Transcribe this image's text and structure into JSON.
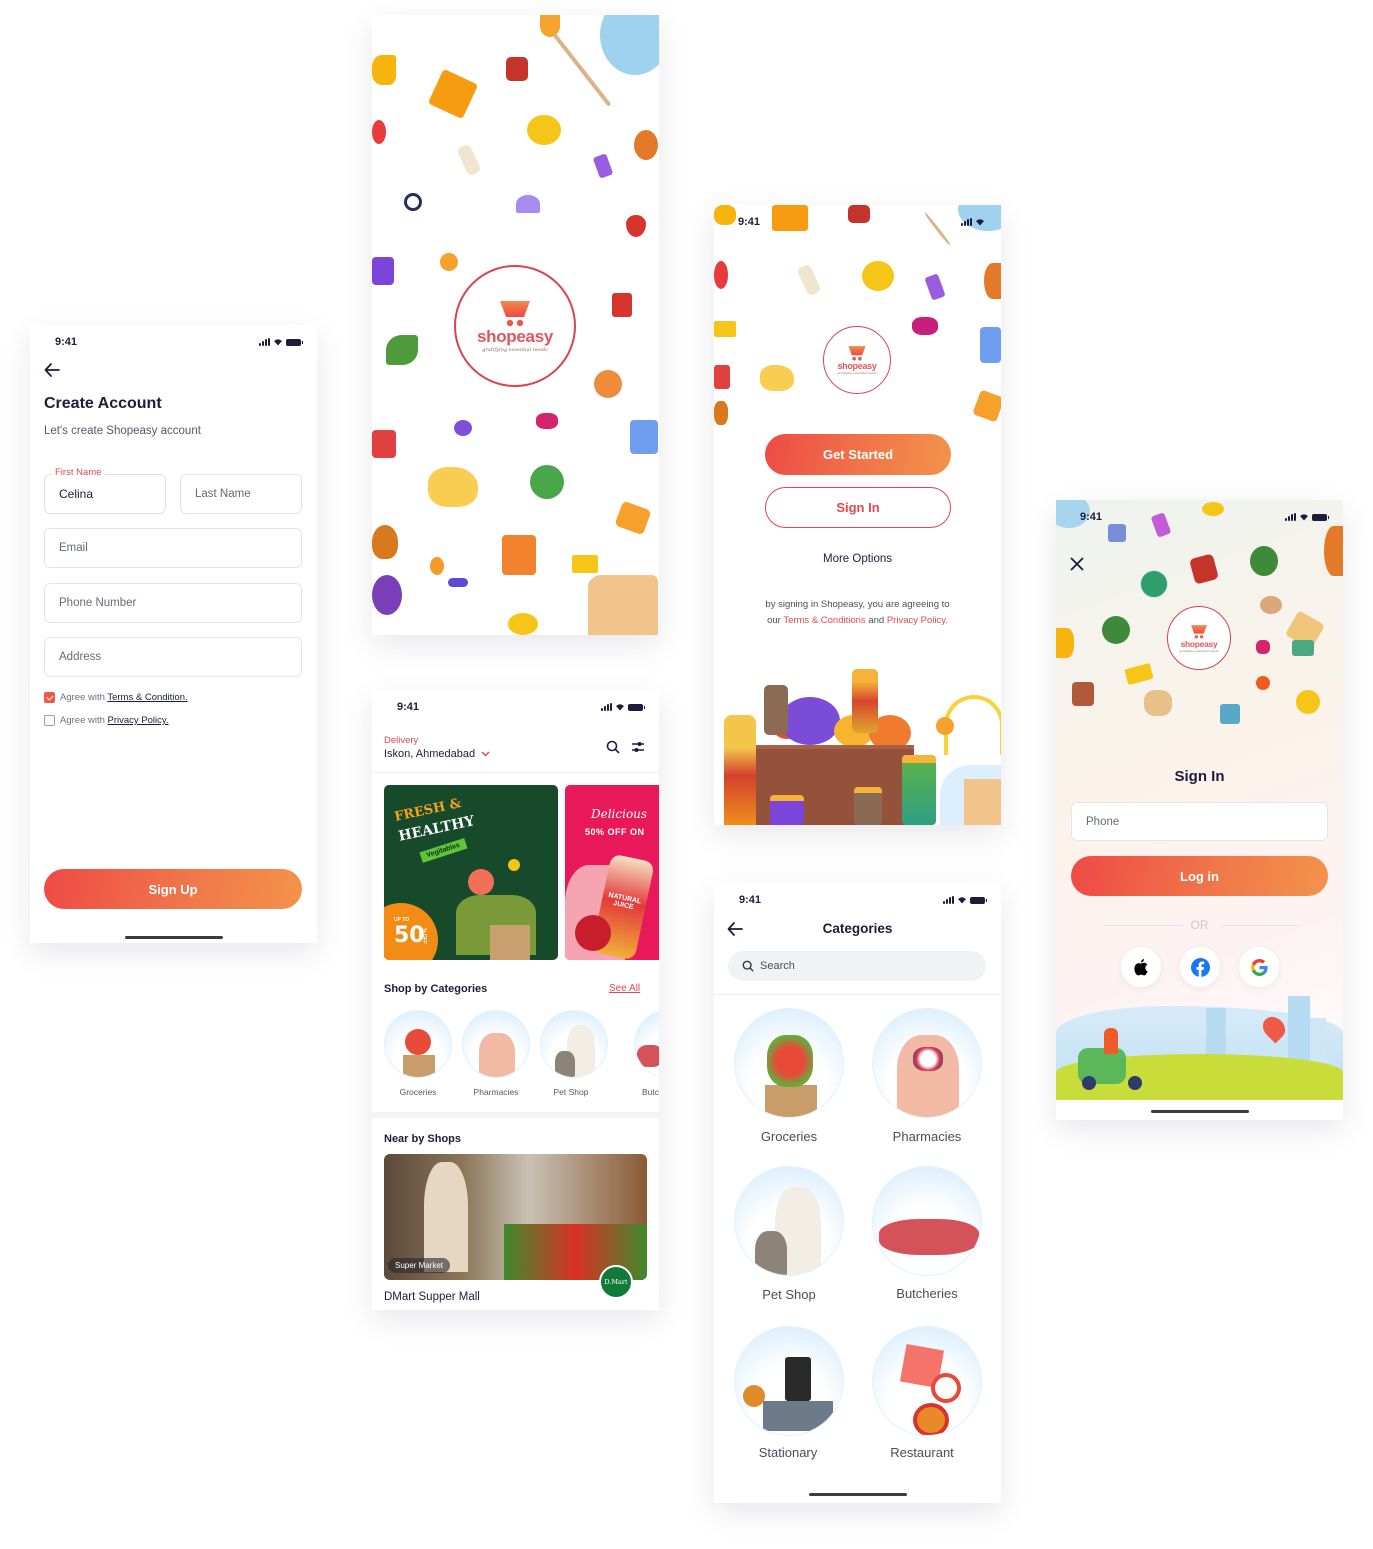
{
  "status_time": "9:41",
  "colors": {
    "accent": "#e3474f",
    "gradient_start": "#ee4a45",
    "gradient_end": "#f4924b",
    "text_dark": "#1b1d3b",
    "banner_green": "#174a2a",
    "banner_pink": "#e8185a",
    "dmart_green": "#117a3a"
  },
  "brand": {
    "name": "shopeasy",
    "tagline": "gratifying essential needs"
  },
  "create_account": {
    "title": "Create Account",
    "subtitle": "Let's create Shopeasy account",
    "first_name_label": "First Name",
    "first_name_value": "Celina",
    "last_name_placeholder": "Last Name",
    "email_placeholder": "Email",
    "phone_placeholder": "Phone Number",
    "address_placeholder": "Address",
    "agreements": [
      {
        "prefix": "Agree with ",
        "link": "Terms & Condition.",
        "checked": true
      },
      {
        "prefix": "Agree with ",
        "link": "Privacy Policy.",
        "checked": false
      }
    ],
    "signup_button": "Sign Up"
  },
  "home": {
    "delivery_label": "Delivery",
    "delivery_location": "Iskon, Ahmedabad",
    "banners": [
      {
        "line1": "FRESH &",
        "line2": "HEALTHY",
        "tag": "Vegitables",
        "badge_top": "UP TO",
        "badge_value": "50",
        "badge_suffix": "% OFF"
      },
      {
        "line1": "Delicious",
        "line2": "50% OFF ON",
        "product": "NATURAL JUICE"
      }
    ],
    "shop_by_categories_title": "Shop by Categories",
    "see_all": "See All",
    "categories": [
      "Groceries",
      "Pharmacies",
      "Pet Shop",
      "Butc"
    ],
    "nearby_title": "Near by Shops",
    "shop": {
      "tag": "Super Market",
      "name": "DMart Supper Mall",
      "logo_text": "D​.Mart"
    }
  },
  "get_started": {
    "get_started_button": "Get Started",
    "sign_in_button": "Sign In",
    "more_options": "More Options",
    "legal_line1": "by signing in  Shopeasy, you are agreeing to",
    "legal_our": "our ",
    "legal_terms": "Terms & Conditions",
    "legal_and": " and ",
    "legal_privacy": "Privacy Policy."
  },
  "categories_screen": {
    "title": "Categories",
    "search_placeholder": "Search",
    "items": [
      "Groceries",
      "Pharmacies",
      "Pet Shop",
      "Butcheries",
      "Stationary",
      "Restaurant"
    ]
  },
  "sign_in": {
    "title": "Sign In",
    "phone_placeholder": "Phone",
    "login_button": "Log in",
    "or_label": "OR",
    "social": [
      "apple",
      "facebook",
      "google"
    ]
  }
}
